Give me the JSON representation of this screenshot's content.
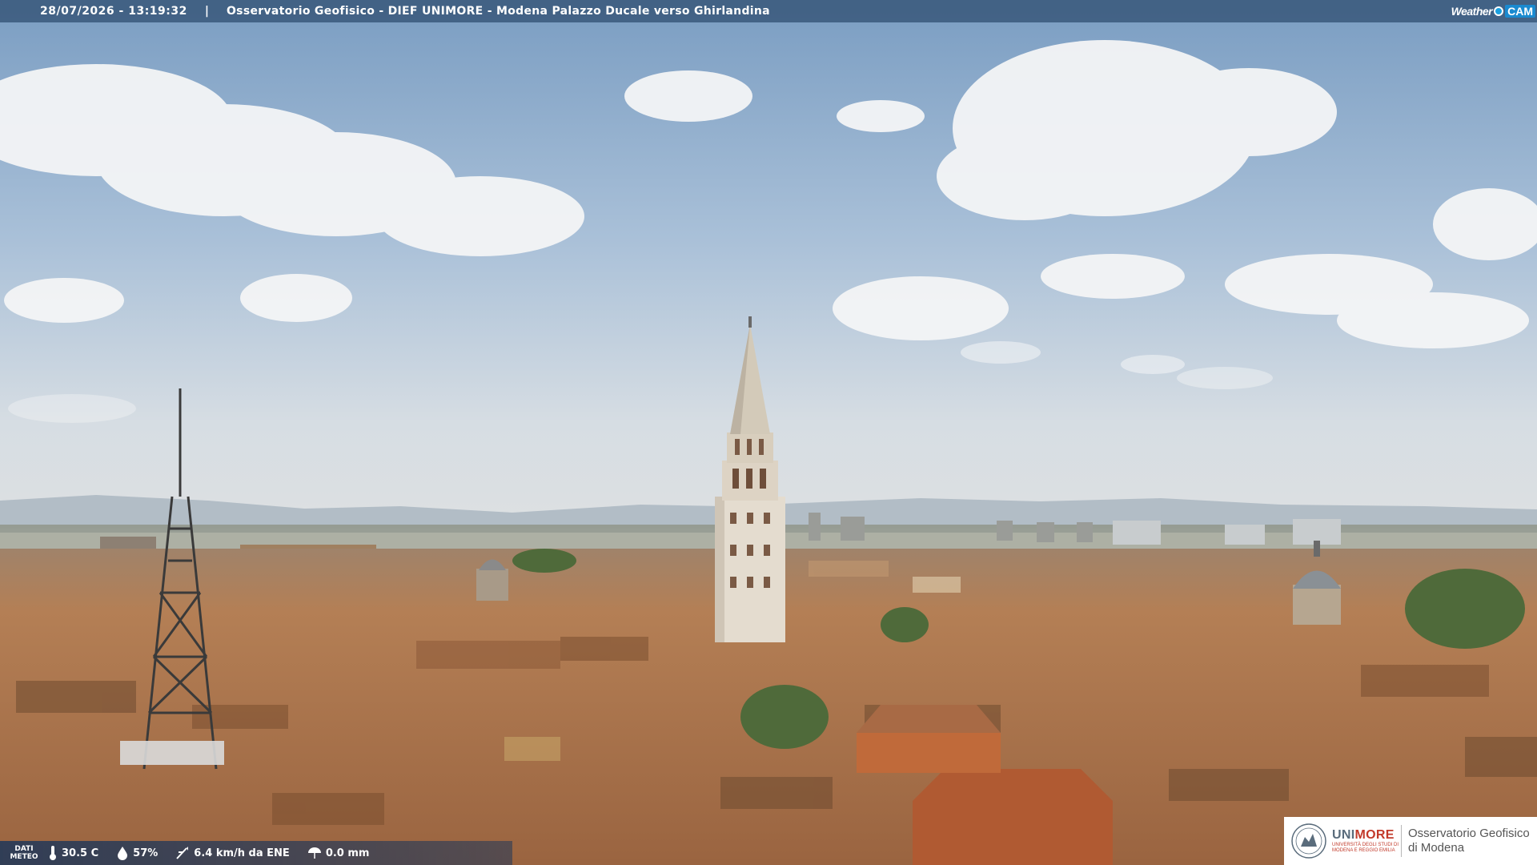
{
  "header": {
    "timestamp": "28/07/2026 - 13:19:32",
    "separator": "|",
    "title": "Osservatorio Geofisico - DIEF UNIMORE - Modena Palazzo Ducale verso Ghirlandina"
  },
  "logo": {
    "weather": "Weather",
    "cam": "CAM"
  },
  "weather": {
    "label_line1": "DATI",
    "label_line2": "METEO",
    "temperature": "30.5 C",
    "humidity": "57%",
    "wind": "6.4 km/h da ENE",
    "rain": "0.0 mm"
  },
  "institution": {
    "name_part1": "UNI",
    "name_part2": "MORE",
    "subtitle_line1": "UNIVERSITÀ DEGLI STUDI DI",
    "subtitle_line2": "MODENA E REGGIO EMILIA",
    "observatory_line1": "Osservatorio Geofisico",
    "observatory_line2": "di Modena"
  },
  "colors": {
    "sky_top": "#7d9fc2",
    "sky_bottom": "#d9dde0",
    "roof": "#b0784e",
    "accent_red": "#c23a2a"
  }
}
